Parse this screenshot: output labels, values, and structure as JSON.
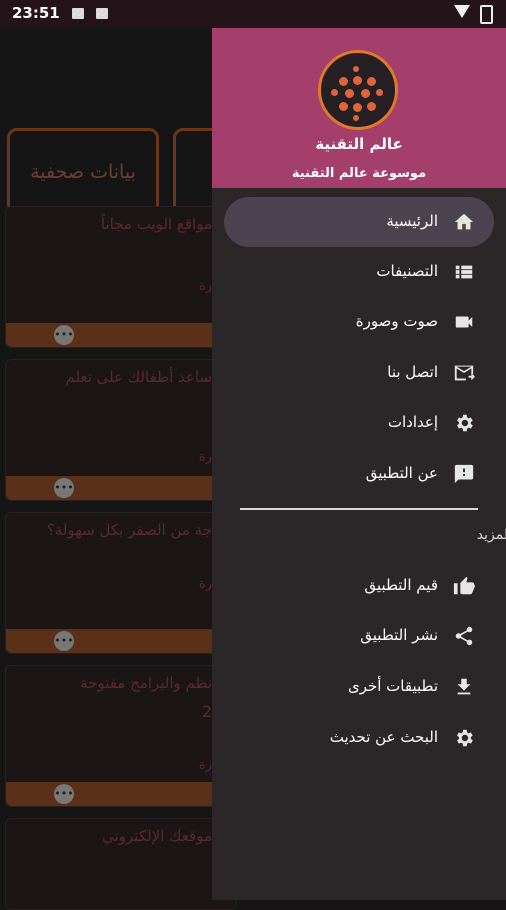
{
  "status_bar": {
    "time": "23:51"
  },
  "background": {
    "category_label": "بيانات صحفية",
    "cards": [
      {
        "title": "مواقع الويب مجاناً",
        "small": "رة"
      },
      {
        "title": "ساعد أطفالك على تعلم",
        "small": "رة"
      },
      {
        "title": "جة من الصفر بكل سهولة؟",
        "small": "رة"
      },
      {
        "title": "نظم والبرامج مفتوحة",
        "extra": "2",
        "small": "رة"
      },
      {
        "title": "موقعك الإلكتروني",
        "small": ""
      }
    ]
  },
  "drawer": {
    "app_name": "عالم التقنية",
    "app_subtitle": "موسوعة عالم التقنية",
    "items": [
      {
        "label": "الرئيسية",
        "icon": "home-icon",
        "active": true
      },
      {
        "label": "التصنيفات",
        "icon": "list-icon"
      },
      {
        "label": "صوت وصورة",
        "icon": "videocam-icon"
      },
      {
        "label": "اتصل بنا",
        "icon": "mail-icon"
      },
      {
        "label": "إعدادات",
        "icon": "settings-icon"
      },
      {
        "label": "عن التطبيق",
        "icon": "feedback-icon"
      }
    ],
    "section_label": "المزيد",
    "more_items": [
      {
        "label": "قيم التطبيق",
        "icon": "thumbs-up-icon"
      },
      {
        "label": "نشر التطبيق",
        "icon": "share-icon"
      },
      {
        "label": "تطبيقات أخرى",
        "icon": "download-icon"
      },
      {
        "label": "البحث عن تحديث",
        "icon": "settings-icon"
      }
    ]
  },
  "colors": {
    "drawer_header": "#a33f6a",
    "drawer_bg": "#2b2628",
    "accent": "#e07a2a"
  }
}
